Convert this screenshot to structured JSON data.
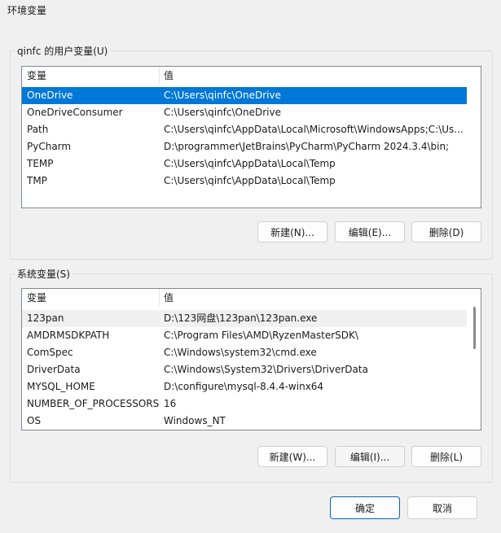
{
  "window": {
    "title": "环境变量"
  },
  "user_vars": {
    "group_label": "qinfc 的用户变量(U)",
    "columns": [
      "变量",
      "值"
    ],
    "rows": [
      {
        "name": "OneDrive",
        "value": "C:\\Users\\qinfc\\OneDrive"
      },
      {
        "name": "OneDriveConsumer",
        "value": "C:\\Users\\qinfc\\OneDrive"
      },
      {
        "name": "Path",
        "value": "C:\\Users\\qinfc\\AppData\\Local\\Microsoft\\WindowsApps;C:\\Us..."
      },
      {
        "name": "PyCharm",
        "value": "D:\\programmer\\JetBrains\\PyCharm\\PyCharm 2024.3.4\\bin;"
      },
      {
        "name": "TEMP",
        "value": "C:\\Users\\qinfc\\AppData\\Local\\Temp"
      },
      {
        "name": "TMP",
        "value": "C:\\Users\\qinfc\\AppData\\Local\\Temp"
      }
    ],
    "selected_row": "OneDrive",
    "buttons": {
      "new": "新建(N)...",
      "edit": "编辑(E)...",
      "delete": "删除(D)"
    }
  },
  "system_vars": {
    "group_label": "系统变量(S)",
    "columns": [
      "变量",
      "值"
    ],
    "rows": [
      {
        "name": "123pan",
        "value": "D:\\123网盘\\123pan\\123pan.exe"
      },
      {
        "name": "AMDRMSDKPATH",
        "value": "C:\\Program Files\\AMD\\RyzenMasterSDK\\"
      },
      {
        "name": "ComSpec",
        "value": "C:\\Windows\\system32\\cmd.exe"
      },
      {
        "name": "DriverData",
        "value": "C:\\Windows\\System32\\Drivers\\DriverData"
      },
      {
        "name": "MYSQL_HOME",
        "value": "D:\\configure\\mysql-8.4.4-winx64"
      },
      {
        "name": "NUMBER_OF_PROCESSORS",
        "value": "16"
      },
      {
        "name": "OS",
        "value": "Windows_NT"
      }
    ],
    "buttons": {
      "new": "新建(W)...",
      "edit": "编辑(I)...",
      "delete": "删除(L)"
    }
  },
  "dialog_buttons": {
    "ok": "确定",
    "cancel": "取消"
  },
  "colors": {
    "selection": "#0078d7",
    "focus_border": "#0067c0",
    "background": "#f0f0f0"
  }
}
